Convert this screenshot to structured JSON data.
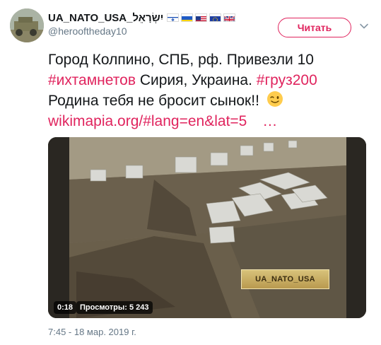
{
  "author": {
    "display_name": "UA_NATO_USA_יִשְׂרָאֵל",
    "handle": "@herooftheday10",
    "flags": [
      "israel-flag-icon",
      "ukraine-flag-icon",
      "usa-flag-icon",
      "eu-flag-icon",
      "uk-flag-icon"
    ]
  },
  "follow_button": {
    "label": "Читать"
  },
  "tweet": {
    "line1": "Город Колпино, СПБ, рф. Привезли 10",
    "line2_tag": "#ихтамнетов",
    "line2_mid": " Сирия, Украина. ",
    "line2_tag2": "#груз200",
    "line3": "Родина тебя не бросит сынок!! ",
    "link": "wikimapia.org/#lang=en&lat=5",
    "link_ellipsis": "…"
  },
  "video": {
    "watermark": "UA_NATO_USA",
    "duration": "0:18",
    "views": "Просмотры: 5 243"
  },
  "timestamp": "7:45 - 18 мар. 2019 г.",
  "colors": {
    "accent": "#e0245e",
    "muted": "#657786",
    "text": "#14171a"
  }
}
